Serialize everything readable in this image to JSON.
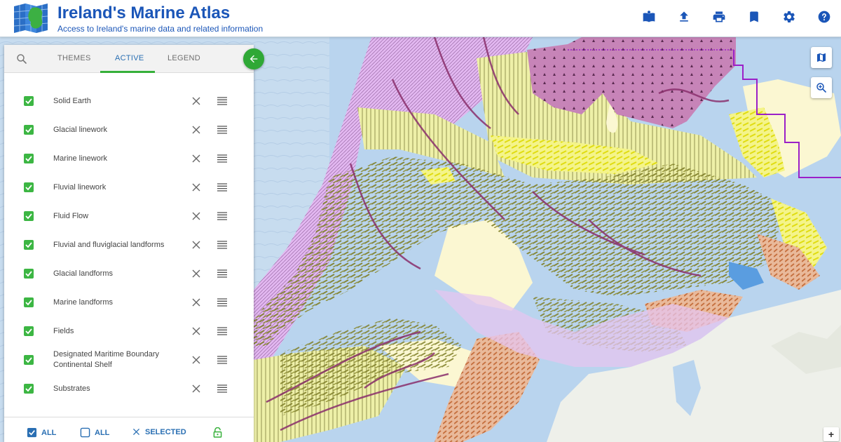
{
  "app": {
    "title": "Ireland's Marine Atlas",
    "subtitle": "Access to Ireland's marine data and related information"
  },
  "toolbar": [
    {
      "icon": "open-book-icon"
    },
    {
      "icon": "upload-icon"
    },
    {
      "icon": "print-icon"
    },
    {
      "icon": "bookmark-icon"
    },
    {
      "icon": "gear-icon"
    },
    {
      "icon": "help-icon"
    }
  ],
  "tabs": {
    "themes": "THEMES",
    "active": "ACTIVE",
    "legend": "LEGEND",
    "active_tab": "active"
  },
  "layers": [
    {
      "name": "Solid Earth",
      "checked": true
    },
    {
      "name": "Glacial linework",
      "checked": true
    },
    {
      "name": "Marine linework",
      "checked": true
    },
    {
      "name": "Fluvial linework",
      "checked": true
    },
    {
      "name": "Fluid Flow",
      "checked": true
    },
    {
      "name": "Fluvial and fluviglacial landforms",
      "checked": true
    },
    {
      "name": "Glacial landforms",
      "checked": true
    },
    {
      "name": "Marine landforms",
      "checked": true
    },
    {
      "name": "Fields",
      "checked": true
    },
    {
      "name": "Designated Maritime Boundary Continental Shelf",
      "checked": true
    },
    {
      "name": "Substrates",
      "checked": true
    }
  ],
  "footer": {
    "select_all": "ALL",
    "deselect_all": "ALL",
    "remove_selected": "SELECTED",
    "lock_icon": "lock-open-icon"
  },
  "map_controls": {
    "basemap_icon": "map-icon",
    "zoom_icon": "zoom-in-icon",
    "zoom_plus": "+"
  },
  "colors": {
    "brand_blue": "#1b56b8",
    "accent_green": "#36b03a",
    "sea": "#cfe0f0",
    "shelf": "#b9d4ee",
    "land": "#eef0ea",
    "olive": "#8a8a2e",
    "pale_yellow": "#fbf7d2",
    "lilac": "#e2b7f0",
    "plum": "#c27fb6",
    "boundary": "#9b20c8"
  }
}
